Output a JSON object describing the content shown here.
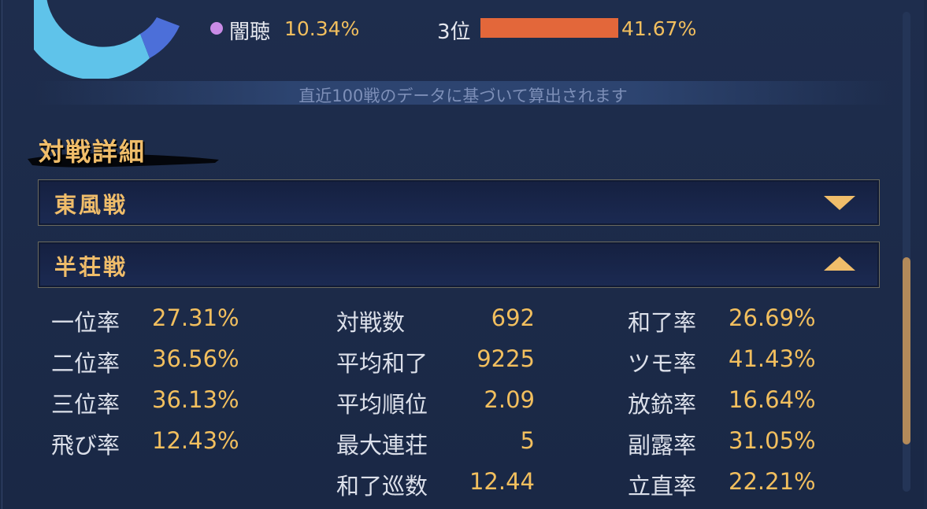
{
  "chart_data": {
    "type": "pie",
    "labels": [
      "闇聴"
    ],
    "values": [
      10.34
    ],
    "title": ""
  },
  "summary": {
    "legend_name": "闇聴",
    "legend_value": "10.34%",
    "legend_color": "#c98be6",
    "rank_label": "3位",
    "rank_value": "41.67%",
    "rank_fraction": 0.4167,
    "rank_color": "#e3673a"
  },
  "note": "直近100戦のデータに基づいて算出されます",
  "section_title": "対戦詳細",
  "accordions": [
    {
      "label": "東風戦",
      "state": "collapsed",
      "icon": "triangle-down-icon"
    },
    {
      "label": "半荘戦",
      "state": "expanded",
      "icon": "triangle-up-icon"
    }
  ],
  "stats": {
    "col1": [
      {
        "label": "一位率",
        "value": "27.31%"
      },
      {
        "label": "二位率",
        "value": "36.56%"
      },
      {
        "label": "三位率",
        "value": "36.13%"
      },
      {
        "label": "飛び率",
        "value": "12.43%"
      }
    ],
    "col2": [
      {
        "label": "対戦数",
        "value": "692"
      },
      {
        "label": "平均和了",
        "value": "9225"
      },
      {
        "label": "平均順位",
        "value": "2.09"
      },
      {
        "label": "最大連荘",
        "value": "5"
      },
      {
        "label": "和了巡数",
        "value": "12.44"
      }
    ],
    "col3": [
      {
        "label": "和了率",
        "value": "26.69%"
      },
      {
        "label": "ツモ率",
        "value": "41.43%"
      },
      {
        "label": "放銃率",
        "value": "16.64%"
      },
      {
        "label": "副露率",
        "value": "31.05%"
      },
      {
        "label": "立直率",
        "value": "22.21%"
      }
    ]
  },
  "colors": {
    "accent_gold": "#f0bd6a",
    "value_yellow": "#f2bf5e",
    "donut_light": "#5ec2ea",
    "donut_blue": "#4a6fd8"
  }
}
